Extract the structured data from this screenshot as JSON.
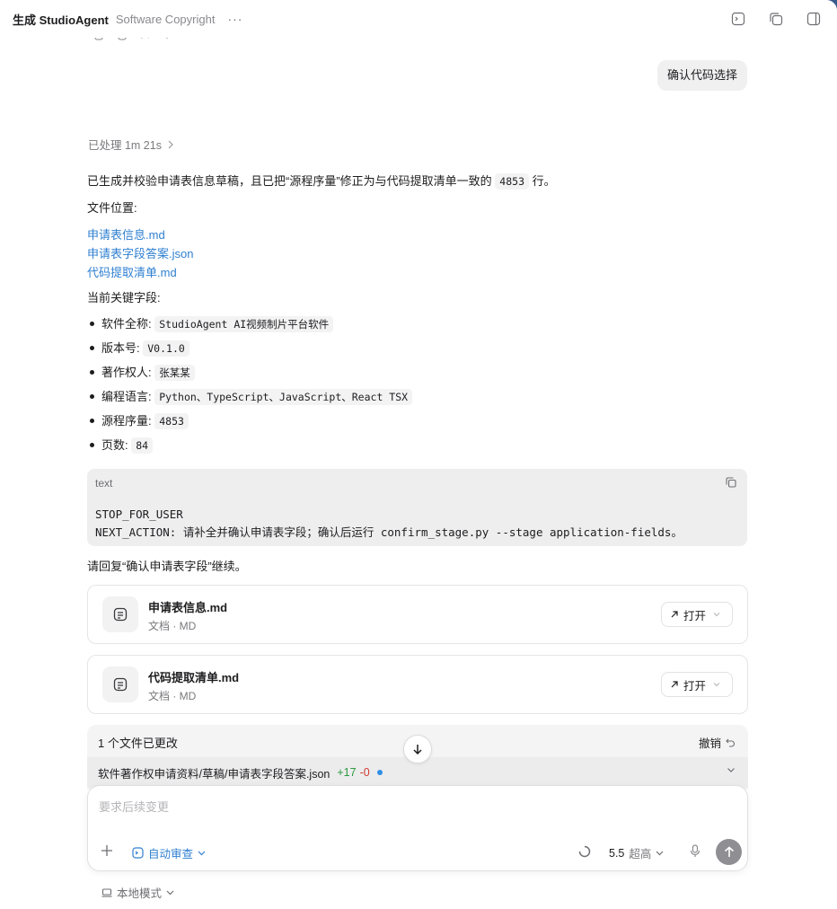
{
  "window": {
    "title": "生成 StudioAgent",
    "subtitle": "Software Copyright",
    "more": "···"
  },
  "icons": {
    "toolbar": [
      "terminal-icon",
      "copy-window-icon",
      "sidebar-toggle-icon"
    ],
    "message_actions": [
      "copy-icon",
      "copy-icon",
      "thumbs-up-icon",
      "thumbs-down-icon"
    ]
  },
  "user_message": "确认代码选择",
  "processed": "已处理 1m 21s",
  "summary": {
    "before": "已生成并校验申请表信息草稿，且已把“源程序量”修正为与代码提取清单一致的",
    "value": "4853",
    "after": "行。"
  },
  "file_location_label": "文件位置:",
  "links": [
    "申请表信息.md",
    "申请表字段答案.json",
    "代码提取清单.md"
  ],
  "key_fields_label": "当前关键字段:",
  "fields": [
    {
      "label": "软件全称:",
      "value": "StudioAgent AI视频制片平台软件"
    },
    {
      "label": "版本号:",
      "value": "V0.1.0"
    },
    {
      "label": "著作权人:",
      "value": "张某某"
    },
    {
      "label": "编程语言:",
      "value": "Python、TypeScript、JavaScript、React TSX"
    },
    {
      "label": "源程序量:",
      "value": "4853"
    },
    {
      "label": "页数:",
      "value": "84"
    }
  ],
  "codeblock": {
    "lang": "text",
    "line1": "STOP_FOR_USER",
    "line2": "NEXT_ACTION: 请补全并确认申请表字段；确认后运行 confirm_stage.py --stage application-fields。"
  },
  "reply_hint": "请回复“确认申请表字段”继续。",
  "files": [
    {
      "name": "申请表信息.md",
      "meta": "文档 · MD",
      "action": "打开"
    },
    {
      "name": "代码提取清单.md",
      "meta": "文档 · MD",
      "action": "打开"
    }
  ],
  "changes": {
    "title": "1 个文件已更改",
    "undo": "撤销",
    "path": "软件著作权申请资料/草稿/申请表字段答案.json",
    "added": "+17",
    "removed": "-0",
    "dot_color": "#2f8fe6"
  },
  "composer": {
    "placeholder": "要求后续变更",
    "review": "自动审查",
    "model": "5.5",
    "level": "超高"
  },
  "local_mode": "本地模式",
  "colors": {
    "link": "#2f7fd1",
    "added": "#2a9a3e",
    "removed": "#d13b30"
  }
}
